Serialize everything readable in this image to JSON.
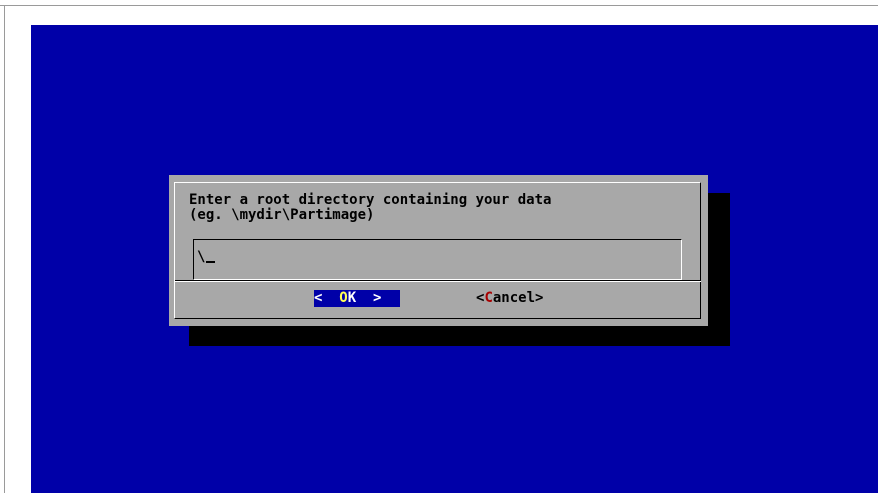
{
  "dialog": {
    "prompt_line1": "Enter a root directory containing your data",
    "prompt_line2": "(eg. \\mydir\\Partimage)",
    "input_value": "\\",
    "buttons": {
      "ok": {
        "open": "<",
        "hot": "O",
        "rest": "K",
        "close": ">"
      },
      "cancel": {
        "open": "<",
        "hot": "C",
        "rest": "ancel",
        "close": ">"
      }
    }
  },
  "colors": {
    "console_background": "#0000a8",
    "dialog_background": "#a8a8a8",
    "dialog_shadow": "#000000",
    "focused_button_background": "#0000a8",
    "focused_button_text": "#ffffff",
    "hotkey_focused": "#ffff55",
    "hotkey_unfocused": "#a80000"
  }
}
